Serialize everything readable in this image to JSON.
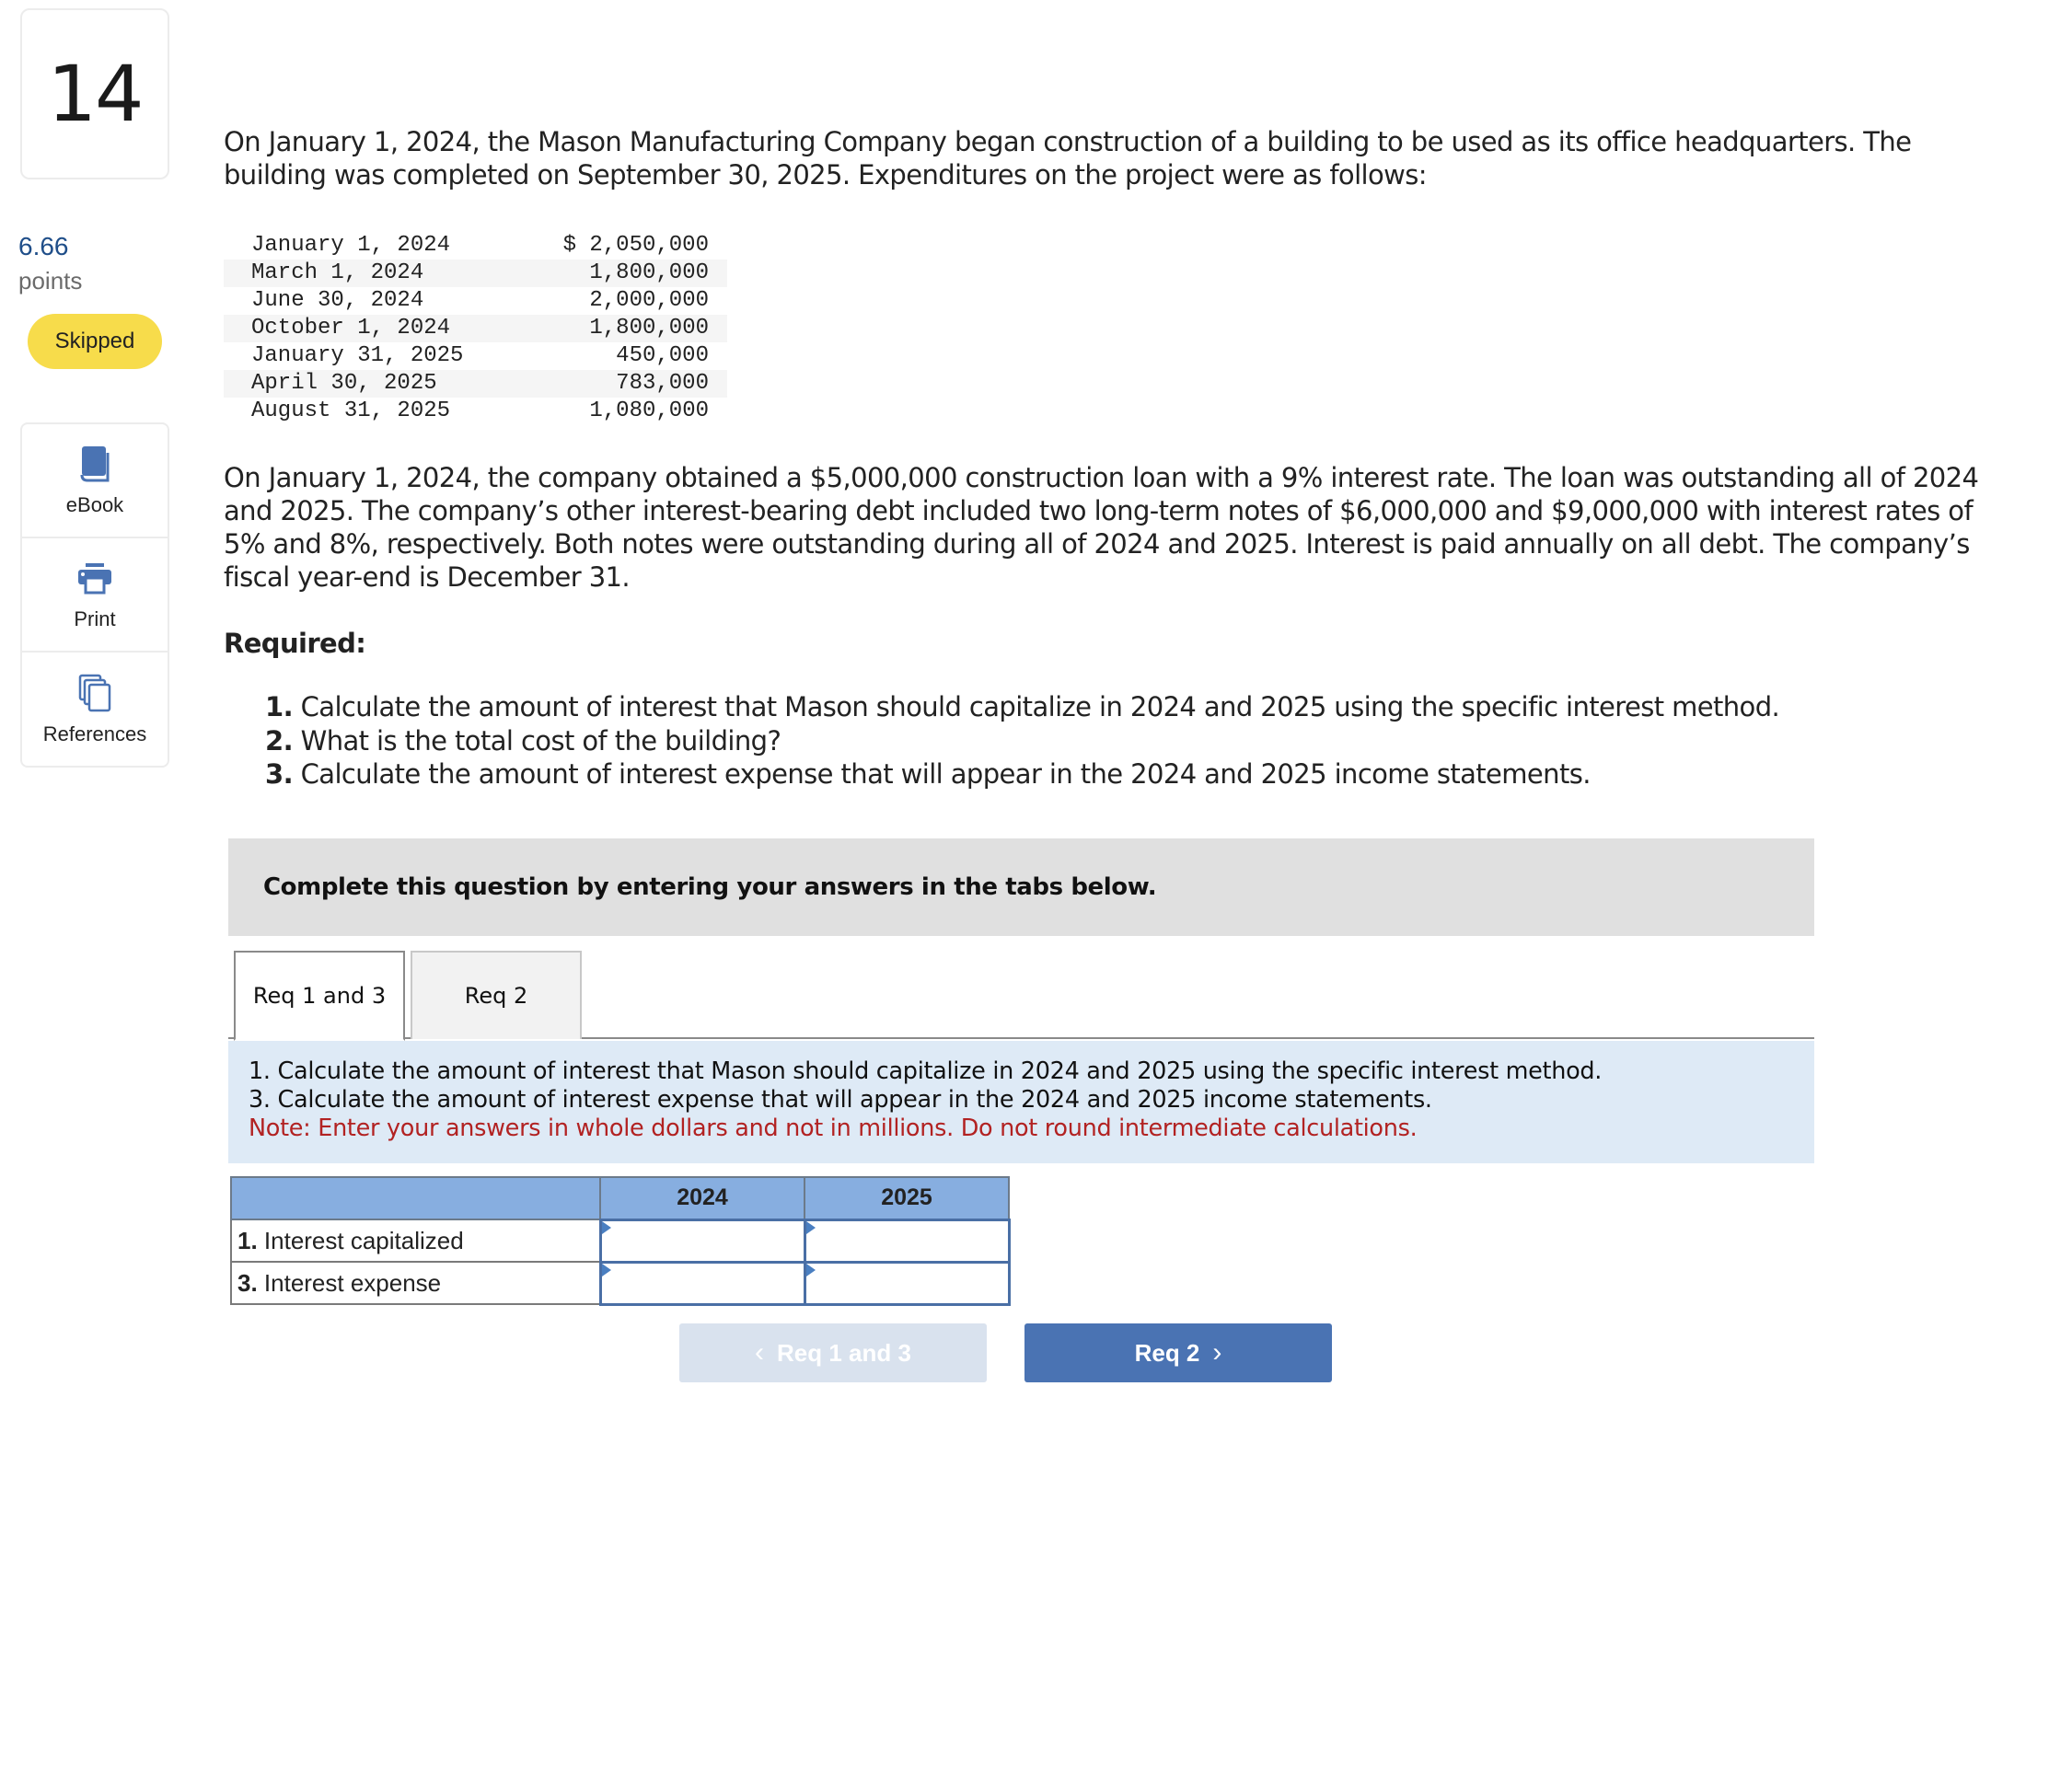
{
  "sidebar": {
    "question_number": "14",
    "points_value": "6.66",
    "points_label": "points",
    "status_badge": "Skipped",
    "tools": [
      {
        "label": "eBook",
        "icon": "book-icon"
      },
      {
        "label": "Print",
        "icon": "printer-icon"
      },
      {
        "label": "References",
        "icon": "documents-icon"
      }
    ]
  },
  "question": {
    "paragraph1": "On January 1, 2024, the Mason Manufacturing Company began construction of a building to be used as its office headquarters. The building was completed on September 30, 2025. Expenditures on the project were as follows:",
    "expenditures": [
      {
        "date": "January 1, 2024",
        "amount": "$ 2,050,000"
      },
      {
        "date": "March 1, 2024",
        "amount": "1,800,000"
      },
      {
        "date": "June 30, 2024",
        "amount": "2,000,000"
      },
      {
        "date": "October 1, 2024",
        "amount": "1,800,000"
      },
      {
        "date": "January 31, 2025",
        "amount": "450,000"
      },
      {
        "date": "April 30, 2025",
        "amount": "783,000"
      },
      {
        "date": "August 31, 2025",
        "amount": "1,080,000"
      }
    ],
    "paragraph2": "On January 1, 2024, the company obtained a $5,000,000 construction loan with a 9% interest rate. The loan was outstanding all of 2024 and 2025. The company’s other interest-bearing debt included two long-term notes of $6,000,000 and $9,000,000 with interest rates of 5% and 8%, respectively. Both notes were outstanding during all of 2024 and 2025. Interest is paid annually on all debt. The company’s fiscal year-end is December 31.",
    "required_heading": "Required:",
    "required_items": [
      {
        "num": "1.",
        "text": " Calculate the amount of interest that Mason should capitalize in 2024 and 2025 using the specific interest method."
      },
      {
        "num": "2.",
        "text": " What is the total cost of the building?"
      },
      {
        "num": "3.",
        "text": " Calculate the amount of interest expense that will appear in the 2024 and 2025 income statements."
      }
    ]
  },
  "answer_area": {
    "instruction": "Complete this question by entering your answers in the tabs below.",
    "tabs": [
      {
        "label": "Req 1 and 3",
        "active": true
      },
      {
        "label": "Req 2",
        "active": false
      }
    ],
    "description_lines": [
      "1. Calculate the amount of interest that Mason should capitalize in 2024 and 2025 using the specific interest method.",
      "3. Calculate the amount of interest expense that will appear in the 2024 and 2025 income statements."
    ],
    "note": "Note: Enter your answers in whole dollars and not in millions. Do not round intermediate calculations.",
    "table": {
      "columns": [
        "",
        "2024",
        "2025"
      ],
      "rows": [
        {
          "num": "1.",
          "label": " Interest capitalized",
          "values": [
            "",
            ""
          ]
        },
        {
          "num": "3.",
          "label": " Interest expense",
          "values": [
            "",
            ""
          ]
        }
      ]
    },
    "nav": {
      "prev_label": "Req 1 and 3",
      "next_label": "Req 2",
      "prev_icon": "‹",
      "next_icon": "›"
    }
  },
  "colors": {
    "accent_blue": "#4a73b3",
    "skipped_yellow": "#f7dc4b",
    "note_red": "#b22222",
    "table_header_blue": "#87aee0",
    "description_bg": "#deeaf6"
  }
}
